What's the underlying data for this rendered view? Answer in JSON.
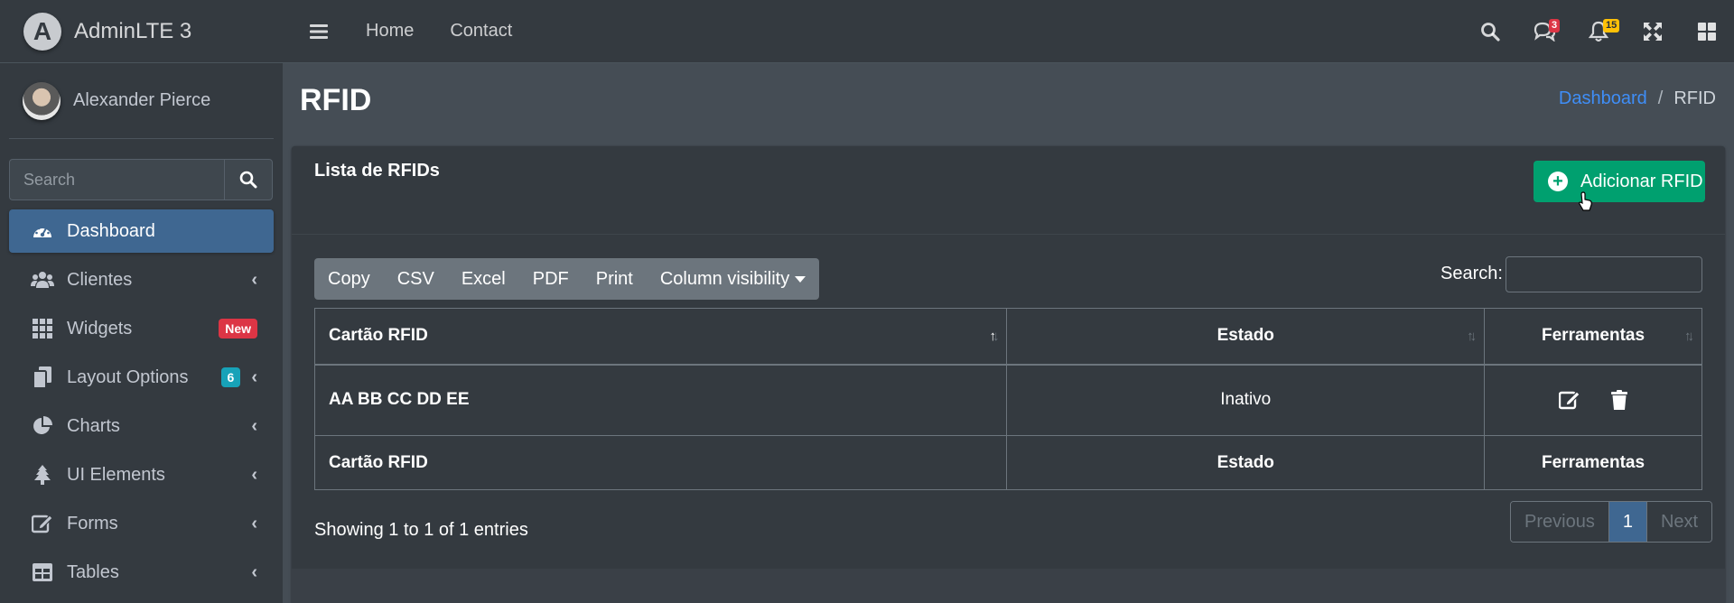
{
  "brand": {
    "name": "AdminLTE 3",
    "logo_letter": "A"
  },
  "user": {
    "name": "Alexander Pierce"
  },
  "sidebar_search": {
    "placeholder": "Search"
  },
  "sidebar": {
    "items": [
      {
        "label": "Dashboard",
        "icon": "tachometer-icon"
      },
      {
        "label": "Clientes",
        "icon": "users-icon"
      },
      {
        "label": "Widgets",
        "icon": "grid-icon",
        "badge": "New"
      },
      {
        "label": "Layout Options",
        "icon": "copy-icon",
        "badge": "6"
      },
      {
        "label": "Charts",
        "icon": "pie-chart-icon"
      },
      {
        "label": "UI Elements",
        "icon": "tree-icon"
      },
      {
        "label": "Forms",
        "icon": "edit-icon"
      },
      {
        "label": "Tables",
        "icon": "table-icon"
      }
    ]
  },
  "topnav": {
    "links": [
      "Home",
      "Contact"
    ],
    "messages_count": "3",
    "notifications_count": "15"
  },
  "page": {
    "title": "RFID",
    "breadcrumb": {
      "home": "Dashboard",
      "separator": "/",
      "current": "RFID"
    }
  },
  "card": {
    "title": "Lista de RFIDs",
    "add_button": "Adicionar RFID"
  },
  "table_tools": {
    "buttons": [
      "Copy",
      "CSV",
      "Excel",
      "PDF",
      "Print",
      "Column visibility"
    ],
    "search_label": "Search:"
  },
  "table": {
    "headers": [
      "Cartão RFID",
      "Estado",
      "Ferramentas"
    ],
    "rows": [
      {
        "card": "AA BB CC DD EE",
        "status": "Inativo"
      }
    ],
    "footer": [
      "Cartão RFID",
      "Estado",
      "Ferramentas"
    ]
  },
  "pagination": {
    "info": "Showing 1 to 1 of 1 entries",
    "previous": "Previous",
    "current": "1",
    "next": "Next"
  },
  "colors": {
    "sidebar_bg": "#343a40",
    "active_nav": "#3f6791",
    "success": "#00a06f",
    "danger_badge": "#dc3545",
    "info_badge": "#17a2b8",
    "warning_badge": "#ffc107"
  }
}
